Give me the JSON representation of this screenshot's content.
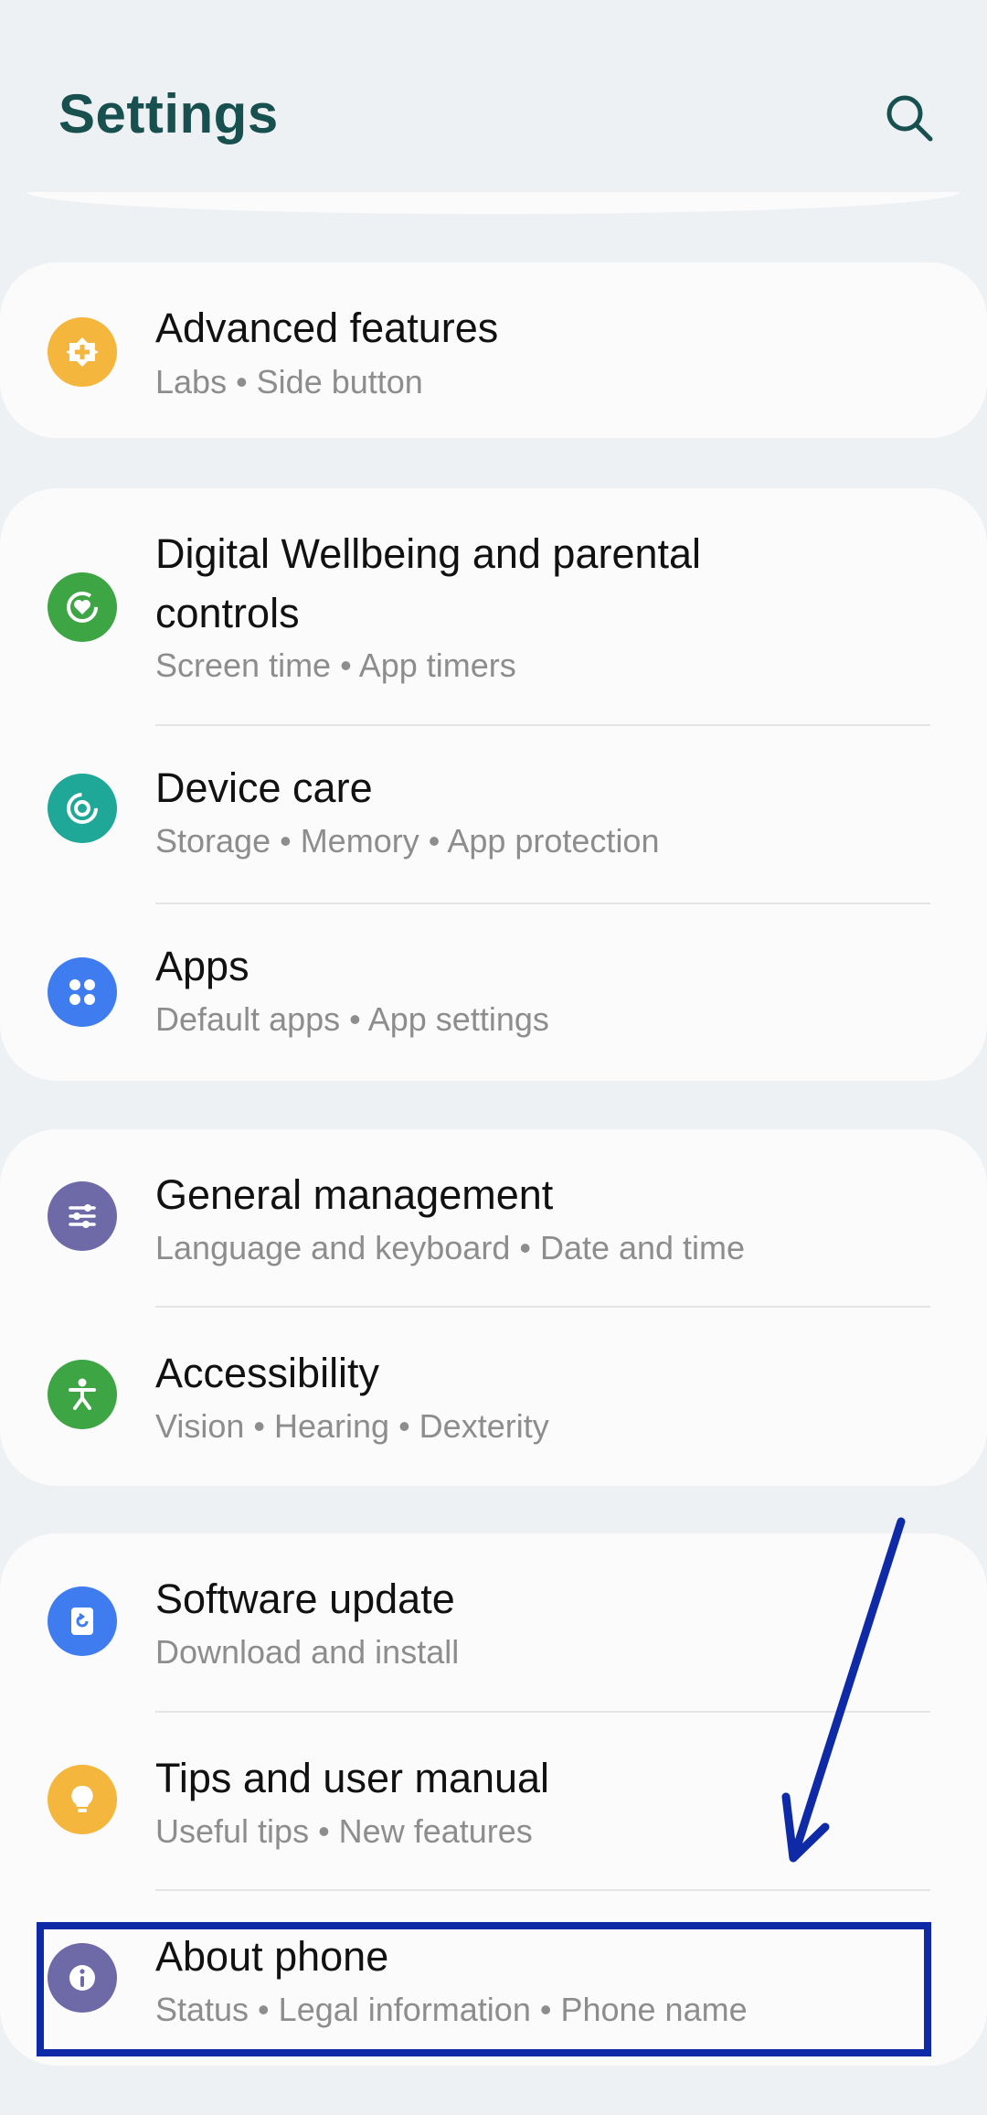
{
  "header": {
    "title": "Settings",
    "search_icon": "search-icon"
  },
  "colors": {
    "background": "#eef1f3",
    "card": "#fbfbfc",
    "title": "#17504f",
    "subtext": "#8d8d8d",
    "highlight": "#0f2aa6"
  },
  "items": [
    {
      "title": "Advanced features",
      "subtitle": "Labs  •  Side button",
      "icon": "advanced-features-icon",
      "icon_color": "#f5b63d"
    },
    {
      "title_line1": "Digital Wellbeing and parental",
      "title_line2": "controls",
      "subtitle": "Screen time  •  App timers",
      "icon": "digital-wellbeing-icon",
      "icon_color": "#3ea544"
    },
    {
      "title": "Device care",
      "subtitle": "Storage  •  Memory  •  App protection",
      "icon": "device-care-icon",
      "icon_color": "#1fa898"
    },
    {
      "title": "Apps",
      "subtitle": "Default apps  •  App settings",
      "icon": "apps-icon",
      "icon_color": "#3f7cf0"
    },
    {
      "title": "General management",
      "subtitle": "Language and keyboard  •  Date and time",
      "icon": "general-management-icon",
      "icon_color": "#6e6aa8"
    },
    {
      "title": "Accessibility",
      "subtitle": "Vision  •  Hearing  •  Dexterity",
      "icon": "accessibility-icon",
      "icon_color": "#3ea544"
    },
    {
      "title": "Software update",
      "subtitle": "Download and install",
      "icon": "software-update-icon",
      "icon_color": "#3f7cf0"
    },
    {
      "title": "Tips and user manual",
      "subtitle": "Useful tips  •  New features",
      "icon": "tips-icon",
      "icon_color": "#f5b63d"
    },
    {
      "title": "About phone",
      "subtitle": "Status  •  Legal information  •  Phone name",
      "icon": "info-icon",
      "icon_color": "#6e6aa8"
    }
  ],
  "annotation": {
    "arrow": "blue-arrow",
    "box": "highlight-box",
    "target": "About phone"
  }
}
